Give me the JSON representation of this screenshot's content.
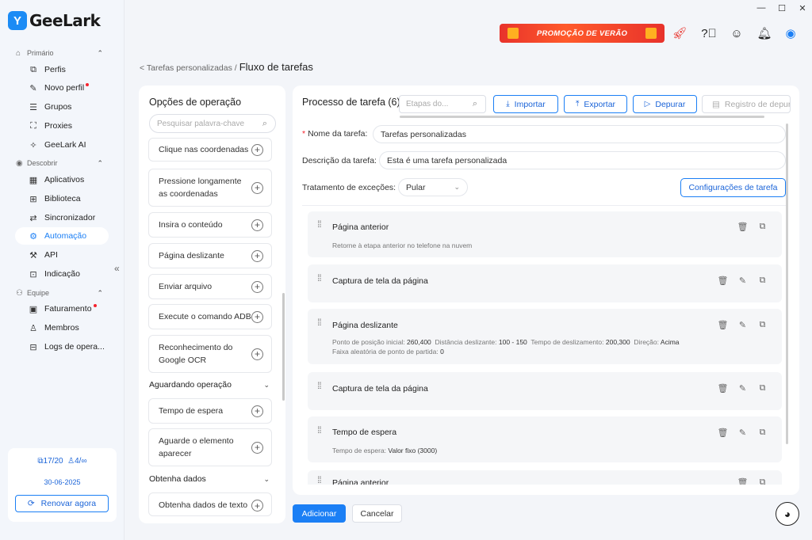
{
  "app": {
    "name": "GeeLark",
    "logo_glyph": "Y"
  },
  "window": {
    "minimize": "—",
    "maximize": "☐",
    "close": "✕"
  },
  "sidebar": {
    "sections": [
      {
        "label": "Primário",
        "icon": "home-icon"
      },
      {
        "label": "Descobrir",
        "icon": "discover-icon"
      },
      {
        "label": "Equipe",
        "icon": "team-icon"
      }
    ],
    "items": [
      {
        "label": "Perfis",
        "icon": "profiles-icon",
        "glyph": "⧉"
      },
      {
        "label": "Novo perfil",
        "icon": "new-profile-icon",
        "glyph": "✎",
        "dot": true
      },
      {
        "label": "Grupos",
        "icon": "groups-icon",
        "glyph": "☰"
      },
      {
        "label": "Proxies",
        "icon": "proxies-icon",
        "glyph": "⛶"
      },
      {
        "label": "GeeLark AI",
        "icon": "ai-icon",
        "glyph": "✧"
      },
      {
        "label": "Aplicativos",
        "icon": "apps-icon",
        "glyph": "▦"
      },
      {
        "label": "Biblioteca",
        "icon": "library-icon",
        "glyph": "⊞"
      },
      {
        "label": "Sincronizador",
        "icon": "sync-icon",
        "glyph": "⇄"
      },
      {
        "label": "Automação",
        "icon": "automation-icon",
        "glyph": "⚙",
        "active": true
      },
      {
        "label": "API",
        "icon": "api-icon",
        "glyph": "⚒"
      },
      {
        "label": "Indicação",
        "icon": "gift-icon",
        "glyph": "⊡"
      },
      {
        "label": "Faturamento",
        "icon": "billing-icon",
        "glyph": "▣",
        "dot": true
      },
      {
        "label": "Membros",
        "icon": "members-icon",
        "glyph": "♙"
      },
      {
        "label": "Logs de opera...",
        "icon": "logs-icon",
        "glyph": "⊟"
      }
    ],
    "quota": {
      "profiles": "17/20",
      "members": "4/∞",
      "date": "30-06-2025",
      "renew": "Renovar agora"
    }
  },
  "topbar": {
    "promo": "PROMOÇÃO DE VERÃO"
  },
  "breadcrumb": {
    "parent": "< Tarefas personalizadas /",
    "current": "Fluxo de tarefas"
  },
  "operations": {
    "title": "Opções de operação",
    "search_placeholder": "Pesquisar palavra-chave",
    "items": [
      "Clique nas coordenadas",
      "Pressione longamente as coordenadas",
      "Insira o conteúdo",
      "Página deslizante",
      "Enviar arquivo",
      "Execute o comando ADB",
      "Reconhecimento do Google OCR",
      "Tempo de espera",
      "Aguarde o elemento aparecer",
      "Obtenha dados de texto"
    ],
    "groups": [
      "Aguardando operação",
      "Obtenha dados"
    ]
  },
  "process": {
    "title": "Processo de tarefa (6)",
    "steps_placeholder": "Etapas do...",
    "import": "Importar",
    "export": "Exportar",
    "debug": "Depurar",
    "debug_log": "Registro de depur",
    "name_label": "Nome da tarefa",
    "name_value": "Tarefas personalizadas",
    "desc_label": "Descrição da tarefa",
    "desc_value": "Esta é uma tarefa personalizada",
    "exception_label": "Tratamento de exceções",
    "exception_value": "Pular",
    "settings_button": "Configurações de tarefa",
    "steps": [
      {
        "title": "Página anterior",
        "desc": "Retorne à etapa anterior no telefone na nuvem"
      },
      {
        "title": "Captura de tela da página"
      },
      {
        "title": "Página deslizante",
        "params": [
          {
            "label": "Ponto de posição inicial:",
            "value": "260,400"
          },
          {
            "label": "Distância deslizante:",
            "value": "100 - 150"
          },
          {
            "label": "Tempo de deslizamento:",
            "value": "200,300"
          },
          {
            "label": "Direção:",
            "value": "Acima"
          }
        ],
        "param2": {
          "label": "Faixa aleatória de ponto de partida:",
          "value": "0"
        }
      },
      {
        "title": "Captura de tela da página"
      },
      {
        "title": "Tempo de espera",
        "param": {
          "label": "Tempo de espera:",
          "value": "Valor fixo (3000)"
        }
      },
      {
        "title": "Página anterior"
      }
    ]
  },
  "footer": {
    "add": "Adicionar",
    "cancel": "Cancelar"
  },
  "colors": {
    "accent": "#1b7ff5",
    "promo": "#e8322b",
    "dot": "#f5222d"
  }
}
